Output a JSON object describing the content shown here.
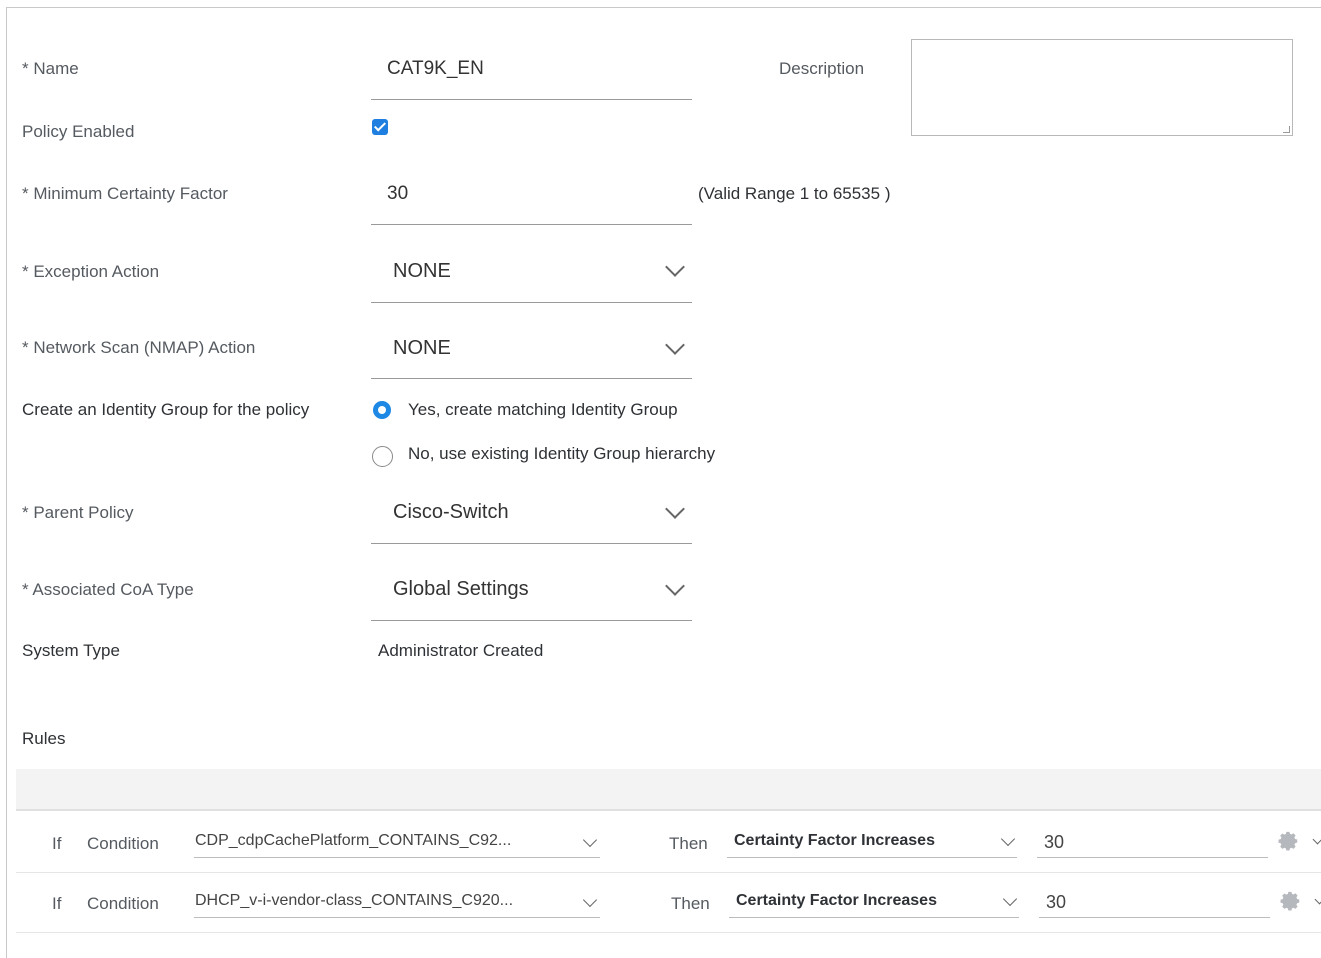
{
  "form": {
    "name_label": "* Name",
    "name_value": "CAT9K_EN",
    "description_label": "Description",
    "description_value": "",
    "policy_enabled_label": "Policy Enabled",
    "policy_enabled": true,
    "min_certainty_label": "* Minimum Certainty Factor",
    "min_certainty_value": "30",
    "min_certainty_hint": "(Valid Range 1 to 65535 )",
    "exception_action_label": "* Exception Action",
    "exception_action_value": "NONE",
    "nmap_action_label": "* Network Scan (NMAP) Action",
    "nmap_action_value": "NONE",
    "identity_group_label": "Create an Identity Group for the policy",
    "identity_group_options": [
      {
        "label": "Yes, create matching Identity Group",
        "selected": true
      },
      {
        "label": "No, use existing Identity Group hierarchy",
        "selected": false
      }
    ],
    "parent_policy_label": "* Parent Policy",
    "parent_policy_value": "Cisco-Switch",
    "coa_type_label": "* Associated CoA Type",
    "coa_type_value": "Global Settings",
    "system_type_label": "System Type",
    "system_type_value": "Administrator Created"
  },
  "rules": {
    "heading": "Rules",
    "rows": [
      {
        "if_label": "If",
        "condition_label": "Condition",
        "condition_value": "CDP_cdpCachePlatform_CONTAINS_C92...",
        "then_label": "Then",
        "action_value": "Certainty Factor Increases",
        "factor_value": "30",
        "icon": "gear-icon"
      },
      {
        "if_label": "If",
        "condition_label": "Condition",
        "condition_value": "DHCP_v-i-vendor-class_CONTAINS_C920...",
        "then_label": "Then",
        "action_value": "Certainty Factor Increases",
        "factor_value": "30",
        "icon": "gear-icon"
      }
    ]
  },
  "colors": {
    "accent": "#1e88e5",
    "checkbox": "#1e7fe0",
    "rules_band": "#f3f3f3"
  }
}
